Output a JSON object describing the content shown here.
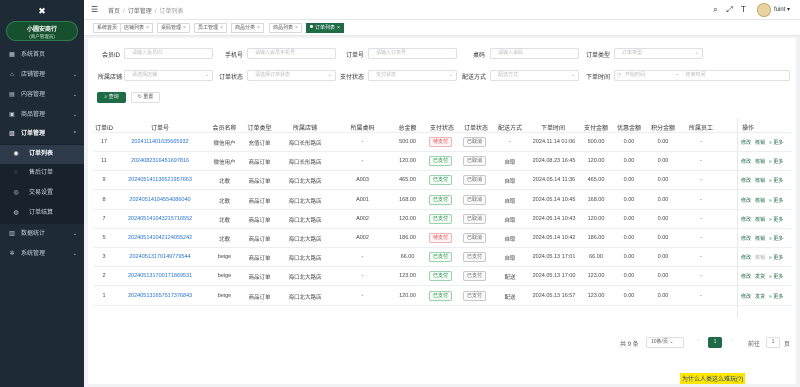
{
  "sidebar": {
    "logo_icon": "cross-tools-icon",
    "brand": {
      "name": "小圆安商行",
      "sub": "(商户管理员)"
    },
    "items": [
      {
        "label": "系统首页",
        "icon": "dashboard-icon"
      },
      {
        "label": "店铺管理",
        "icon": "store-icon"
      },
      {
        "label": "内容管理",
        "icon": "content-icon"
      },
      {
        "label": "商品管理",
        "icon": "goods-icon"
      },
      {
        "label": "订单管理",
        "icon": "order-icon"
      },
      {
        "label": "订单列表",
        "icon": "list-icon"
      },
      {
        "label": "售后订单",
        "icon": "refund-icon"
      },
      {
        "label": "交易设置",
        "icon": "settings-icon"
      },
      {
        "label": "订单结算",
        "icon": "settle-icon"
      },
      {
        "label": "数据统计",
        "icon": "stats-icon"
      },
      {
        "label": "系统管理",
        "icon": "gear-icon"
      }
    ]
  },
  "header": {
    "breadcrumbs": [
      "首页",
      "订单管理",
      "订单列表"
    ],
    "username": "fuint"
  },
  "tags": [
    {
      "label": "系统首页"
    },
    {
      "label": "店铺列表"
    },
    {
      "label": "桌码管理"
    },
    {
      "label": "员工管理"
    },
    {
      "label": "商品分类"
    },
    {
      "label": "商品列表"
    },
    {
      "label": "订单列表"
    }
  ],
  "filters": {
    "member_id": {
      "label": "会员ID",
      "placeholder": "请输入会员ID"
    },
    "phone": {
      "label": "手机号",
      "placeholder": "请输入会员手机号"
    },
    "order_no": {
      "label": "订单号",
      "placeholder": "请输入订单号"
    },
    "table_code": {
      "label": "桌码",
      "placeholder": "请输入桌码"
    },
    "order_type": {
      "label": "订单类型",
      "placeholder": "订单类型"
    },
    "store": {
      "label": "所属店铺",
      "placeholder": "请选择店铺"
    },
    "order_status": {
      "label": "订单状态",
      "placeholder": "请选择订单状态"
    },
    "pay_status": {
      "label": "支付状态",
      "placeholder": "支付状态"
    },
    "delivery": {
      "label": "配送方式",
      "placeholder": "配送方式"
    },
    "order_time": {
      "label": "下单时间",
      "start": "开始时间",
      "sep": "-",
      "end": "结束时间"
    },
    "search_label": "查询",
    "reset_label": "重置"
  },
  "table": {
    "columns": [
      "订单ID",
      "订单号",
      "会员名称",
      "订单类型",
      "所属店铺",
      "所属桌码",
      "总金额",
      "支付状态",
      "订单状态",
      "配送方式",
      "下单时间",
      "支付金额",
      "优惠金额",
      "积分金额",
      "所属员工",
      "操作"
    ],
    "rows": [
      {
        "id": "17",
        "no": "2024111401635665932",
        "member": "微信用户",
        "type": "充值订单",
        "store": "海口长彤路店",
        "table_code": "-",
        "total": "500.00",
        "pay": "待支付",
        "pay_color": "red",
        "status": "已取消",
        "delivery": "-",
        "time": "2024.11.14 01:06",
        "paid": "500.00",
        "discount": "0.00",
        "points": "0.00",
        "staff": "-",
        "a1": "修改",
        "a2": "核销",
        "a3": "更多",
        "a2_disabled": false
      },
      {
        "id": "11",
        "no": "2024082316451697816",
        "member": "微信用户",
        "type": "商品订单",
        "store": "海口长彤路店",
        "table_code": "-",
        "total": "120.00",
        "pay": "已支付",
        "pay_color": "green",
        "status": "已取消",
        "delivery": "自取",
        "time": "2024.08.23 16:45",
        "paid": "120.00",
        "discount": "0.00",
        "points": "0.00",
        "staff": "-",
        "a1": "修改",
        "a2": "核销",
        "a3": "更多",
        "a2_disabled": false
      },
      {
        "id": "9",
        "no": "2024051411365219576​63",
        "member": "北歌",
        "type": "商品订单",
        "store": "海口北大路店",
        "table_code": "A003",
        "total": "465.00",
        "pay": "已支付",
        "pay_color": "green",
        "status": "已取消",
        "delivery": "自取",
        "time": "2024.05.14 11:36",
        "paid": "465.00",
        "discount": "0.00",
        "points": "0.00",
        "staff": "-",
        "a1": "修改",
        "a2": "核销",
        "a3": "更多",
        "a2_disabled": false
      },
      {
        "id": "8",
        "no": "2024051410455408604​0",
        "member": "北歌",
        "type": "商品订单",
        "store": "海口北大路店",
        "table_code": "A001",
        "total": "168.00",
        "pay": "已支付",
        "pay_color": "green",
        "status": "已取消",
        "delivery": "自取",
        "time": "2024.05.14 10:45",
        "paid": "168.00",
        "discount": "0.00",
        "points": "0.00",
        "staff": "-",
        "a1": "修改",
        "a2": "核销",
        "a3": "更多",
        "a2_disabled": false
      },
      {
        "id": "7",
        "no": "2024051410432157165​52",
        "member": "北歌",
        "type": "商品订单",
        "store": "海口北大路店",
        "table_code": "A002",
        "total": "120.00",
        "pay": "已支付",
        "pay_color": "green",
        "status": "已取消",
        "delivery": "自取",
        "time": "2024.05.14 10:43",
        "paid": "120.00",
        "discount": "0.00",
        "points": "0.00",
        "staff": "-",
        "a1": "修改",
        "a2": "核销",
        "a3": "更多",
        "a2_disabled": false
      },
      {
        "id": "5",
        "no": "2024051410421240552​42",
        "member": "北歌",
        "type": "商品订单",
        "store": "海口北大路店",
        "table_code": "A002",
        "total": "186.00",
        "pay": "待支付",
        "pay_color": "red",
        "status": "已取消",
        "delivery": "自取",
        "time": "2024.05.14 10:42",
        "paid": "186.00",
        "discount": "0.00",
        "points": "0.00",
        "staff": "-",
        "a1": "修改",
        "a2": "核销",
        "a3": "更多",
        "a2_disabled": false
      },
      {
        "id": "3",
        "no": "2024051317014977954​4",
        "member": "beige",
        "type": "商品订单",
        "store": "海口北大路店",
        "table_code": "-",
        "total": "66.00",
        "pay": "已支付",
        "pay_color": "green",
        "status": "已支付",
        "delivery": "自取",
        "time": "2024.05.13 17:01",
        "paid": "66.00",
        "discount": "0.00",
        "points": "0.00",
        "staff": "-",
        "a1": "修改",
        "a2": "核销",
        "a3": "更多",
        "a2_disabled": true
      },
      {
        "id": "2",
        "no": "2024051317001718695​31",
        "member": "beige",
        "type": "商品订单",
        "store": "海口北大路店",
        "table_code": "-",
        "total": "123.00",
        "pay": "已支付",
        "pay_color": "green",
        "status": "已支付",
        "delivery": "配送",
        "time": "2024.05.13 17:00",
        "paid": "123.00",
        "discount": "0.00",
        "points": "0.00",
        "staff": "-",
        "a1": "修改",
        "a2": "发货",
        "a3": "更多",
        "a2_disabled": false
      },
      {
        "id": "1",
        "no": "2024051316575173768​43",
        "member": "beige",
        "type": "商品订单",
        "store": "海口北大路店",
        "table_code": "-",
        "total": "120.00",
        "pay": "已支付",
        "pay_color": "green",
        "status": "已支付",
        "delivery": "配送",
        "time": "2024.05.13 16:57",
        "paid": "123.00",
        "discount": "0.00",
        "points": "0.00",
        "staff": "-",
        "a1": "修改",
        "a2": "发货",
        "a3": "更多",
        "a2_disabled": false
      }
    ]
  },
  "pagination": {
    "total_text": "共 9 条",
    "page_size": "10条/页",
    "current": "1",
    "goto_label": "前往",
    "goto_value": "1",
    "page_unit": "页"
  },
  "watermark": "为什么人类这么难玩(?)",
  "colors": {
    "accent": "#1e6b45",
    "link": "#1f6fd1",
    "sidebar": "#1f2a37",
    "danger": "#e04a4a"
  }
}
